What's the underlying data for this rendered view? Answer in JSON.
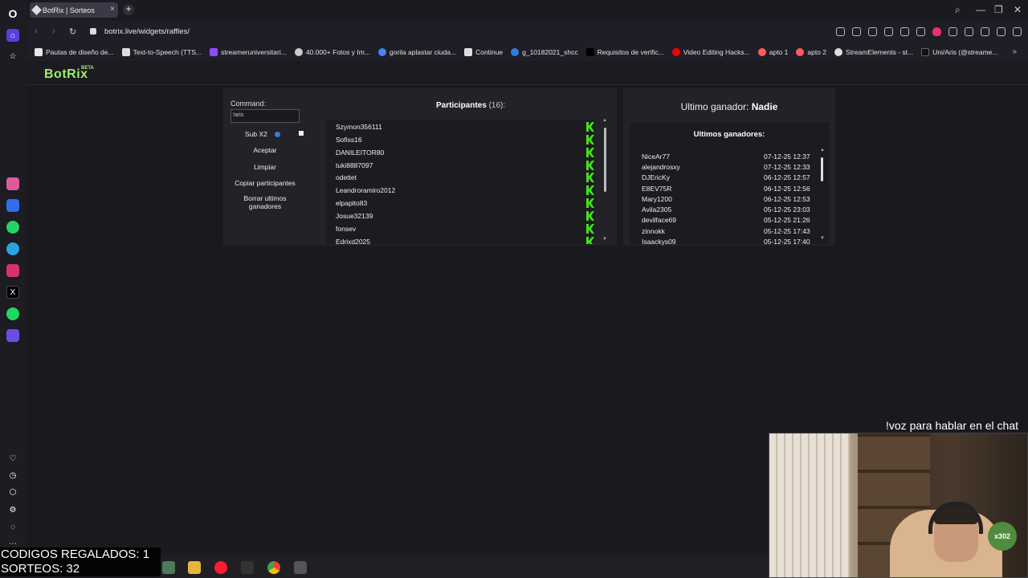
{
  "tab": {
    "title": "BotRix | Sorteos",
    "close": "×",
    "new_tab": "+"
  },
  "address": {
    "url": "botrix.live/widgets/raffles/"
  },
  "bookmarks": [
    "Pautas de diseño de...",
    "Text-to-Speech (TTS...",
    "streameruniversitari...",
    "40.000+ Fotos y Im...",
    "gorila aplastar ciuda...",
    "Continue",
    "g_10182021_shcc",
    "Requisitos de verific...",
    "Video Editing Hacks...",
    "apto 1",
    "apto 2",
    "StreamElements - st...",
    "Uni/Aris (@streame..."
  ],
  "brand": {
    "name": "BotRix",
    "tag": "BETA"
  },
  "raffle": {
    "command_label": "Command:",
    "command_value": "!aris",
    "sub_label": "Sub X2",
    "buttons": {
      "accept": "Aceptar",
      "clear": "Limpiar",
      "copy": "Copiar participantes",
      "delete_line1": "Borrar ultimos",
      "delete_line2": "ganadores"
    }
  },
  "participants": {
    "title": "Participantes",
    "count": "(16):",
    "items": [
      "Szymon356111",
      "Sofiss16",
      "DANILEITOR80",
      "tuki8887097",
      "odettet",
      "Leandroramiro2012",
      "elpapito83",
      "Josue32139",
      "fonsev",
      "Edrixd2025"
    ]
  },
  "winner": {
    "label": "Ultimo ganador:",
    "name": "Nadie",
    "list_title": "Ultimos ganadores:",
    "items": [
      {
        "name": "NiceAr77",
        "date": "07-12-25 12:37"
      },
      {
        "name": "alejandrosxy",
        "date": "07-12-25 12:33"
      },
      {
        "name": "DJEricKy",
        "date": "06-12-25 12:57"
      },
      {
        "name": "E8EV75R",
        "date": "06-12-25 12:56"
      },
      {
        "name": "Mary1200",
        "date": "06-12-25 12:53"
      },
      {
        "name": "Avila2305",
        "date": "05-12-25 23:03"
      },
      {
        "name": "devilface69",
        "date": "05-12-25 21:26"
      },
      {
        "name": "zinnokk",
        "date": "05-12-25 17:43"
      },
      {
        "name": "Isaackys09",
        "date": "05-12-25 17:40"
      }
    ]
  },
  "overlay": {
    "codes": "CODIGOS REGALADOS: 1",
    "raffles": "SORTEOS: 32",
    "voice": "!voz para hablar en el chat",
    "cam_badge": "x302"
  },
  "colors": {
    "brand_green": "#9bf06b",
    "kick_green": "#43e01a",
    "opera_red": "#ff1b2d"
  }
}
